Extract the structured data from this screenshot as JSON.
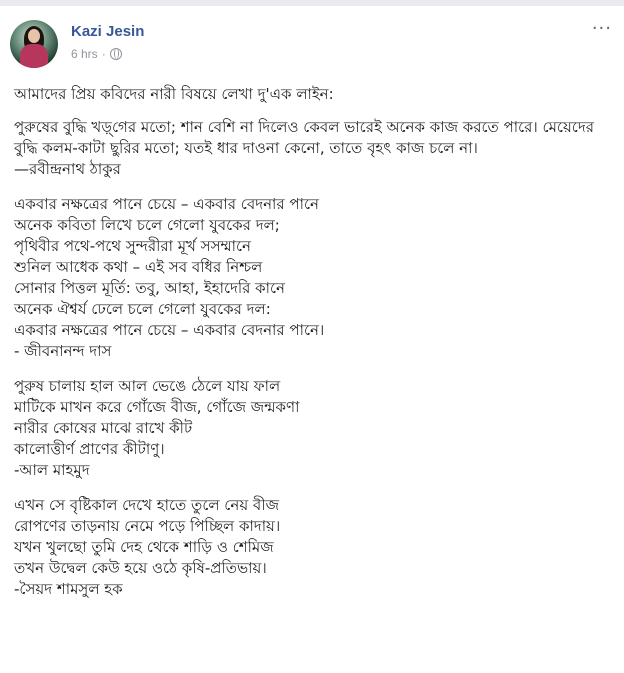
{
  "post": {
    "author": "Kazi Jesin",
    "time": "6 hrs",
    "separator": "·",
    "more_label": "···"
  },
  "icons": {
    "privacy": "globe-icon",
    "more": "ellipsis-icon"
  },
  "content": {
    "intro": "আমাদের প্রিয় কবিদের নারী বিষয়ে লেখা দু'এক লাইন:",
    "quote1": {
      "text": "পুরুষের বুদ্ধি খড়্‌গের মতো; শান বেশি না দিলেও কেবল ভারেই অনেক কাজ করতে পারে। মেয়েদের বুদ্ধি কলম-কাটা ছুরির মতো; যতই ধার দাওনা কেনো, তাতে বৃহৎ কাজ চলে না।",
      "author": "—রবীন্দ্রনাথ ঠাকুর"
    },
    "poem1": {
      "lines": [
        "একবার নক্ষত্রের পানে চেয়ে – একবার বেদনার পানে",
        "অনেক কবিতা লিখে চলে গেলো যুবকের দল;",
        "পৃথিবীর পথে-পথে সুন্দরীরা মূর্খ সসম্মানে",
        "শুনিল আধেক কথা – এই সব বধির নিশ্চল",
        "সোনার পিত্তল মূর্তি: তবু, আহা, ইহাদেরি কানে",
        "অনেক ঐশ্বর্য ঢেলে চলে গেলো যুবকের দল:",
        "একবার নক্ষত্রের পানে চেয়ে – একবার বেদনার পানে।"
      ],
      "author": "- জীবনানন্দ দাস"
    },
    "poem2": {
      "lines": [
        "পুরুষ চালায় হাল আল ভেঙে ঠেলে যায় ফাল",
        "মাটিকে মাখন করে গোঁজে বীজ, গোঁজে জন্মকণা",
        "নারীর কোষের মাঝে রাখে কীট",
        "কালোত্তীর্ণ প্রাণের কীটাণু।"
      ],
      "author": "-আল মাহমুদ"
    },
    "poem3": {
      "lines": [
        "এখন সে বৃষ্টিকাল দেখে হাতে তুলে নেয় বীজ",
        "রোপণের তাড়নায় নেমে পড়ে পিচ্ছিল কাদায়।",
        "যখন খুলছো তুমি দেহ থেকে শাড়ি ও শেমিজ",
        "তখন উদ্বেল কেউ হয়ে ওঠে কৃষি-প্রতিভায়।"
      ],
      "author": "-সৈয়দ শামসুল হক"
    }
  }
}
